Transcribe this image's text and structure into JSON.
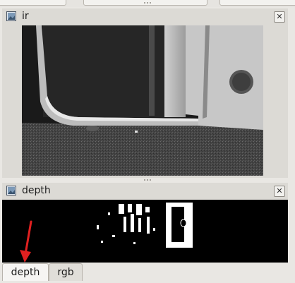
{
  "panels": {
    "ir": {
      "title": "ir",
      "close_icon": "close-icon"
    },
    "depth": {
      "title": "depth",
      "close_icon": "close-icon"
    }
  },
  "tabs": [
    {
      "label": "depth",
      "active": true
    },
    {
      "label": "rgb",
      "active": false
    }
  ],
  "colors": {
    "window_bg": "#e9e7e3",
    "annotation_arrow": "#e02020"
  }
}
